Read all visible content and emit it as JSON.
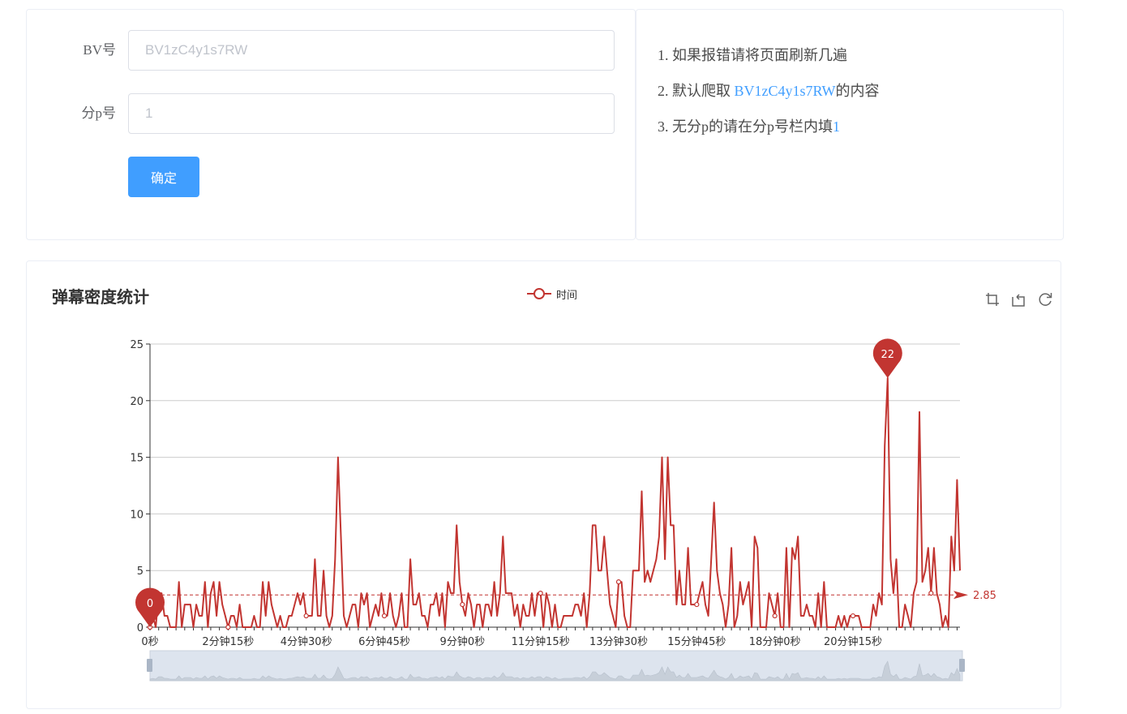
{
  "form": {
    "bv_label": "BV号",
    "bv_placeholder": "BV1zC4y1s7RW",
    "page_label": "分p号",
    "page_placeholder": "1",
    "submit_label": "确定"
  },
  "notes": {
    "items": [
      {
        "prefix": "1. 如果报错请将页面刷新几遍",
        "link": "",
        "suffix": ""
      },
      {
        "prefix": "2. 默认爬取 ",
        "link": "BV1zC4y1s7RW",
        "suffix": "的内容"
      },
      {
        "prefix": "3. 无分p的请在分p号栏内填",
        "link": "1",
        "suffix": ""
      }
    ]
  },
  "colors": {
    "series": "#c23531",
    "primary": "#409eff",
    "grid": "#cccccc"
  },
  "toolbox": {
    "icons": [
      "zoom-icon",
      "zoom-back-icon",
      "restore-icon"
    ]
  },
  "chart_data": {
    "type": "line",
    "title": "弹幕密度统计",
    "legend": [
      "时间"
    ],
    "legend_position": "top-center",
    "grid": true,
    "ylim": [
      0,
      25
    ],
    "yticks": [
      0,
      5,
      10,
      15,
      20,
      25
    ],
    "xtick_labels": [
      "0秒",
      "2分钟15秒",
      "4分钟30秒",
      "6分钟45秒",
      "9分钟0秒",
      "11分钟15秒",
      "13分钟30秒",
      "15分钟45秒",
      "18分钟0秒",
      "20分钟15秒"
    ],
    "x_interval_seconds": 5,
    "series": [
      {
        "name": "时间",
        "values": [
          0,
          1,
          0,
          3,
          3,
          1,
          1,
          0,
          0,
          0,
          4,
          0,
          2,
          2,
          2,
          0,
          2,
          1,
          1,
          4,
          0,
          3,
          4,
          1,
          4,
          2,
          1,
          0,
          1,
          1,
          0,
          2,
          0,
          0,
          0,
          0,
          1,
          0,
          0,
          4,
          1,
          4,
          2,
          1,
          0,
          1,
          0,
          0,
          1,
          1,
          2,
          3,
          2,
          3,
          1,
          1,
          1,
          6,
          1,
          1,
          5,
          1,
          0,
          1,
          6,
          15,
          8,
          1,
          0,
          1,
          2,
          2,
          0,
          3,
          2,
          3,
          0,
          1,
          2,
          1,
          3,
          1,
          1,
          3,
          1,
          0,
          1,
          3,
          0,
          0,
          6,
          2,
          2,
          3,
          1,
          1,
          0,
          2,
          2,
          3,
          1,
          3,
          0,
          4,
          3,
          3,
          9,
          4,
          2,
          1,
          3,
          2,
          0,
          2,
          2,
          0,
          2,
          2,
          1,
          4,
          1,
          3,
          8,
          3,
          3,
          3,
          1,
          2,
          0,
          2,
          1,
          1,
          3,
          1,
          3,
          3,
          0,
          3,
          2,
          0,
          2,
          0,
          0,
          1,
          1,
          1,
          1,
          2,
          2,
          1,
          3,
          0,
          3,
          9,
          9,
          5,
          5,
          8,
          5,
          2,
          1,
          0,
          4,
          4,
          1,
          0,
          0,
          5,
          5,
          5,
          12,
          4,
          5,
          4,
          5,
          6,
          8,
          15,
          6,
          15,
          9,
          9,
          2,
          5,
          2,
          2,
          7,
          2,
          2,
          2,
          3,
          4,
          2,
          1,
          6,
          11,
          5,
          3,
          2,
          0,
          2,
          7,
          0,
          1,
          4,
          2,
          3,
          4,
          0,
          8,
          7,
          0,
          0,
          0,
          3,
          2,
          1,
          3,
          0,
          0,
          7,
          0,
          7,
          6,
          8,
          1,
          1,
          2,
          1,
          1,
          0,
          3,
          0,
          4,
          0,
          0,
          0,
          0,
          1,
          0,
          1,
          0,
          1,
          1,
          1,
          1,
          0,
          0,
          0,
          0,
          2,
          1,
          3,
          2,
          16,
          22,
          6,
          3,
          6,
          0,
          0,
          2,
          1,
          0,
          3,
          4,
          19,
          4,
          5,
          7,
          3,
          7,
          3,
          2,
          0,
          1,
          0,
          8,
          5,
          13,
          5
        ]
      }
    ],
    "mark_points": [
      {
        "label": "22",
        "type": "max",
        "value": 22
      },
      {
        "label": "0",
        "type": "min",
        "value": 0
      }
    ],
    "mark_line": {
      "label": "2.85",
      "type": "average",
      "value": 2.85
    }
  }
}
